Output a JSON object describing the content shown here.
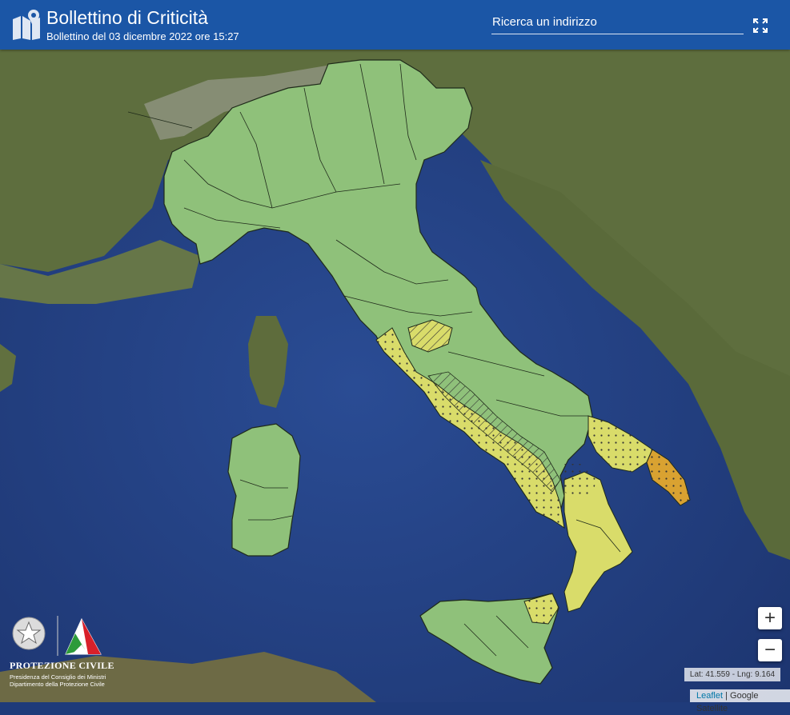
{
  "header": {
    "title": "Bollettino di Criticità",
    "subtitle": "Bollettino del 03 dicembre 2022 ore 15:27",
    "search_placeholder": "Ricerca un indirizzo"
  },
  "icons": {
    "logo": "map-pin-icon",
    "fullscreen": "fullscreen-icon",
    "zoom_in": "plus-icon",
    "zoom_out": "minus-icon"
  },
  "map": {
    "zoom_in_label": "+",
    "zoom_out_label": "−",
    "coordinates": "Lat: 41.559 - Lng: 9.164",
    "attribution_leaflet": "Leaflet",
    "attribution_separator": " | ",
    "attribution_source": "Google Satellite",
    "alert_colors": {
      "green": "#8fc17a",
      "yellow": "#d9dc6a",
      "orange": "#d9a231"
    }
  },
  "logo": {
    "title": "PROTEZIONE CIVILE",
    "line1": "Presidenza del Consiglio dei Ministri",
    "line2": "Dipartimento della Protezione Civile"
  },
  "colors": {
    "header_bg": "#1b56a6",
    "sea": "#25417f",
    "land": "#5a6b3c"
  }
}
